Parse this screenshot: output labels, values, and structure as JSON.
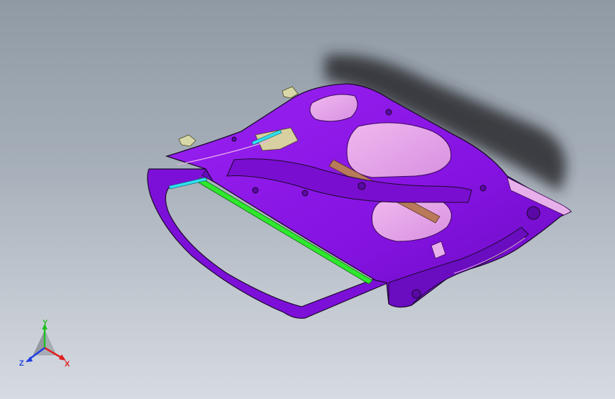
{
  "window": {
    "title": ""
  },
  "viewport": {
    "background_top": "#8f9aa5",
    "background_bottom": "#d6dbe2"
  },
  "model": {
    "name": "car-door-inner-panel",
    "colors": {
      "panel": "#8a15e8",
      "panel_dark": "#5b08a6",
      "cutout": "#e8a8ea",
      "copper": "#b87a5a",
      "seal": "#2ee82e",
      "cyan": "#30e0f0",
      "bracket": "#d8d8a8",
      "edge": "#1a0a2a",
      "shadow": "#2a2a2e"
    }
  },
  "triad": {
    "x_label": "X",
    "y_label": "Y",
    "z_label": "Z",
    "x_color": "#e02020",
    "y_color": "#20c020",
    "z_color": "#2040e0"
  }
}
